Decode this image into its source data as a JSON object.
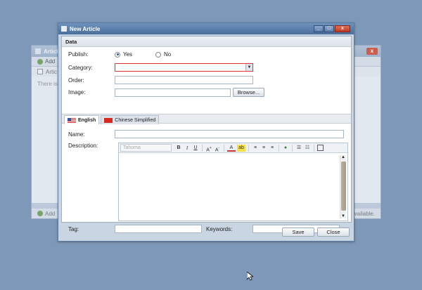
{
  "background_window": {
    "title": "Article",
    "close_label": "x",
    "toolbar_add": "Add",
    "header_col": "Artic",
    "empty_text": "There is",
    "footer_add": "Add",
    "footer_right": "available."
  },
  "dialog": {
    "title": "New Article",
    "minimize": "_",
    "maximize": "□",
    "close": "x",
    "section": "Data",
    "publish": {
      "label": "Publish:",
      "yes": "Yes",
      "no": "No",
      "selected": "Yes"
    },
    "category": {
      "label": "Category:",
      "value": ""
    },
    "order": {
      "label": "Order:",
      "value": ""
    },
    "image": {
      "label": "Image:",
      "value": "",
      "browse": "Browse..."
    },
    "tabs": [
      {
        "label": "English",
        "flag": "us-flag-icon",
        "active": true
      },
      {
        "label": "Chinese Simplified",
        "flag": "cn-flag-icon",
        "active": false
      }
    ],
    "name": {
      "label": "Name:",
      "value": ""
    },
    "description": {
      "label": "Description:"
    },
    "editor": {
      "font": "Tahoma"
    },
    "tag": {
      "label": "Tag:",
      "value": ""
    },
    "keywords": {
      "label": "Keywords:",
      "value": ""
    },
    "save": "Save",
    "cancel": "Close"
  },
  "colors": {
    "desktop": "#7d98b8",
    "titlebar": "#4a6f9c",
    "close": "#c03a25"
  }
}
